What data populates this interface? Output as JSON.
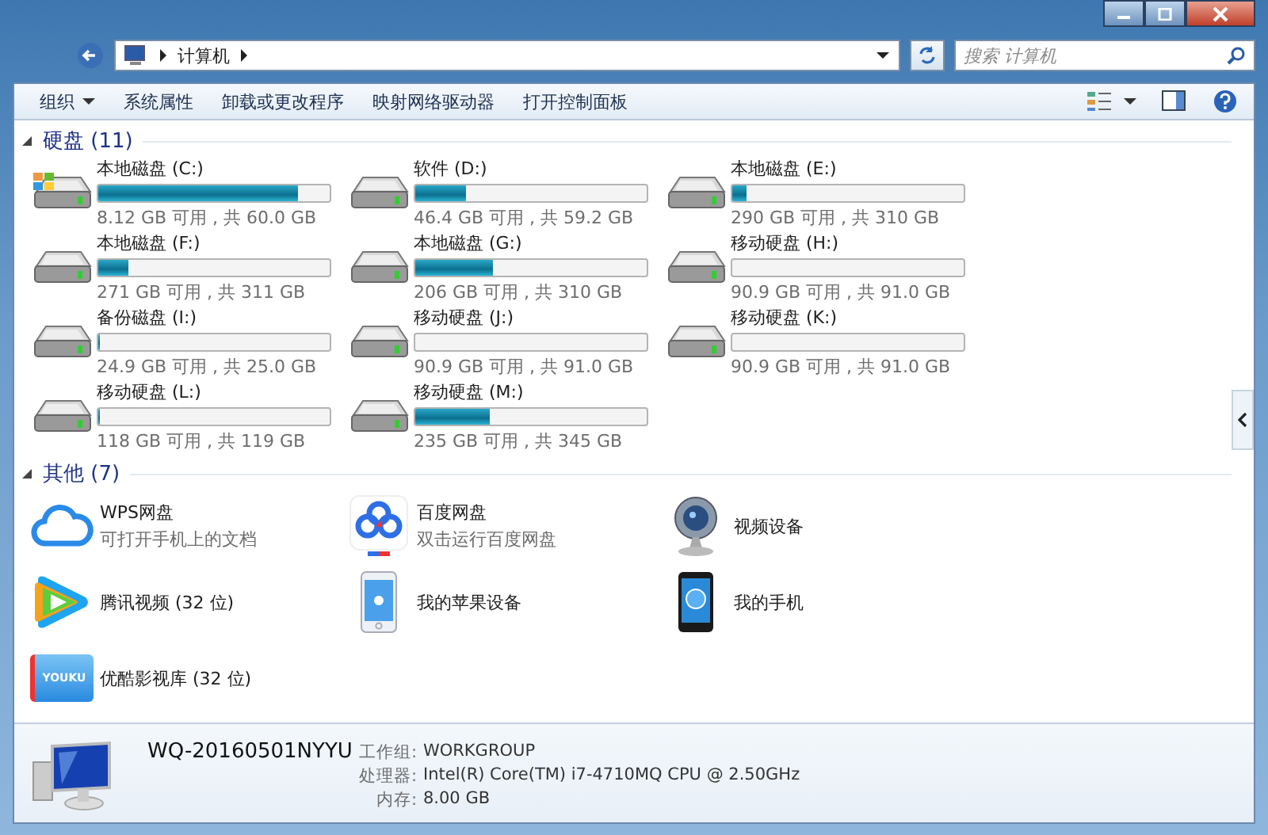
{
  "address": {
    "crumbs": [
      "计算机"
    ]
  },
  "search": {
    "placeholder": "搜索 计算机"
  },
  "toolbar": {
    "items": [
      {
        "label": "组织",
        "kind": "menu"
      },
      {
        "label": "系统属性",
        "kind": "button"
      },
      {
        "label": "卸载或更改程序",
        "kind": "button"
      },
      {
        "label": "映射网络驱动器",
        "kind": "button"
      },
      {
        "label": "打开控制面板",
        "kind": "button"
      }
    ]
  },
  "groups": [
    {
      "title": "硬盘 (11)",
      "expanded": true,
      "items": [
        {
          "kind": "drive",
          "name": "本地磁盘 (C:)",
          "system": true,
          "level": 0.865,
          "info": "8.12 GB 可用 , 共 60.0 GB"
        },
        {
          "kind": "drive",
          "name": "软件 (D:)",
          "system": false,
          "level": 0.216,
          "info": "46.4 GB 可用 , 共 59.2 GB"
        },
        {
          "kind": "drive",
          "name": "本地磁盘 (E:)",
          "system": false,
          "level": 0.065,
          "info": "290 GB 可用 , 共 310 GB"
        },
        {
          "kind": "drive",
          "name": "本地磁盘 (F:)",
          "system": false,
          "level": 0.129,
          "info": "271 GB 可用 , 共 311 GB"
        },
        {
          "kind": "drive",
          "name": "本地磁盘 (G:)",
          "system": false,
          "level": 0.335,
          "info": "206 GB 可用 , 共 310 GB"
        },
        {
          "kind": "drive",
          "name": "移动硬盘 (H:)",
          "system": false,
          "level": 0.001,
          "info": "90.9 GB 可用 , 共 91.0 GB"
        },
        {
          "kind": "drive",
          "name": "备份磁盘 (I:)",
          "system": false,
          "level": 0.004,
          "info": "24.9 GB 可用 , 共 25.0 GB"
        },
        {
          "kind": "drive",
          "name": "移动硬盘 (J:)",
          "system": false,
          "level": 0.001,
          "info": "90.9 GB 可用 , 共 91.0 GB"
        },
        {
          "kind": "drive",
          "name": "移动硬盘 (K:)",
          "system": false,
          "level": 0.001,
          "info": "90.9 GB 可用 , 共 91.0 GB"
        },
        {
          "kind": "drive",
          "name": "移动硬盘 (L:)",
          "system": false,
          "level": 0.008,
          "info": "118 GB 可用 , 共 119 GB"
        },
        {
          "kind": "drive",
          "name": "移动硬盘 (M:)",
          "system": false,
          "level": 0.319,
          "info": "235 GB 可用 , 共 345 GB"
        }
      ]
    },
    {
      "title": "其他 (7)",
      "expanded": true,
      "items": [
        {
          "kind": "cloud",
          "name": "WPS网盘",
          "subtitle": "可打开手机上的文档"
        },
        {
          "kind": "netdisk",
          "name": "百度网盘",
          "subtitle": "双击运行百度网盘"
        },
        {
          "kind": "webcam",
          "name": "视频设备"
        },
        {
          "kind": "video",
          "name": "腾讯视频 (32 位)"
        },
        {
          "kind": "iphone",
          "name": "我的苹果设备"
        },
        {
          "kind": "phone",
          "name": "我的手机"
        },
        {
          "kind": "folder",
          "name": "优酷影视库 (32 位)",
          "icon_text": "YOUKU"
        }
      ]
    }
  ],
  "details": {
    "name": "WQ-20160501NYYU",
    "fields": [
      {
        "label": "工作组:",
        "value": "WORKGROUP"
      },
      {
        "label": "处理器:",
        "value": "Intel(R) Core(TM) i7-4710MQ CPU @ 2.50GHz"
      },
      {
        "label": "内存:",
        "value": "8.00 GB"
      }
    ]
  }
}
